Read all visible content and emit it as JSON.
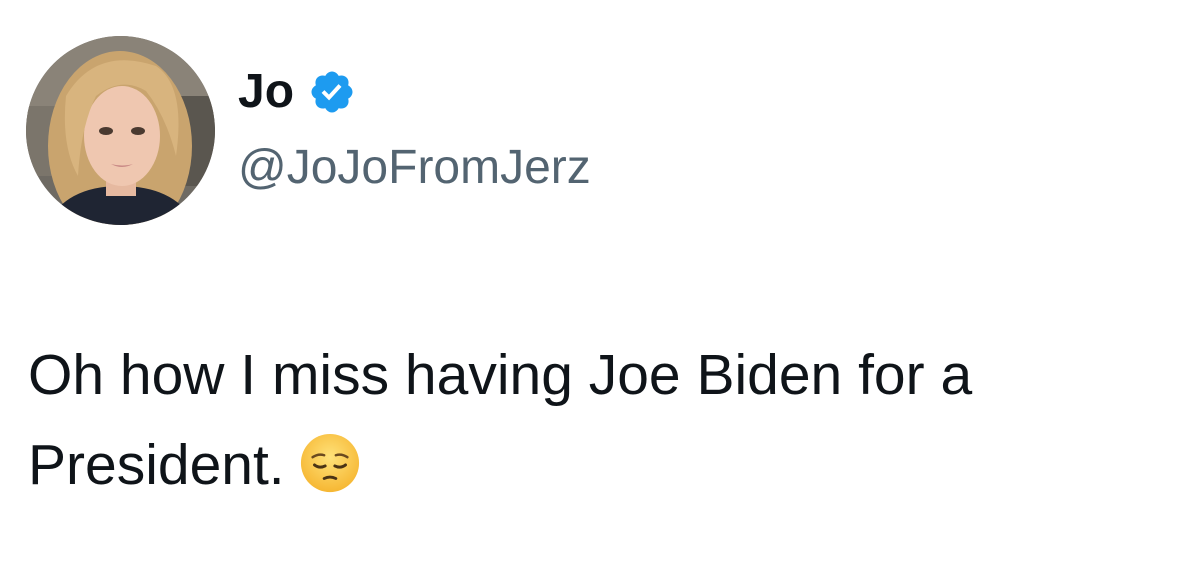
{
  "tweet": {
    "author": {
      "display_name": "Jo",
      "handle": "@JoJoFromJerz",
      "verified": true,
      "avatar_icon": "profile-photo"
    },
    "text": "Oh how I miss having Joe Biden for a President.",
    "emoji": "pensive-face-icon"
  },
  "colors": {
    "text_primary": "#0f1419",
    "text_secondary": "#536471",
    "verified_blue": "#1d9bf0",
    "background": "#ffffff"
  }
}
